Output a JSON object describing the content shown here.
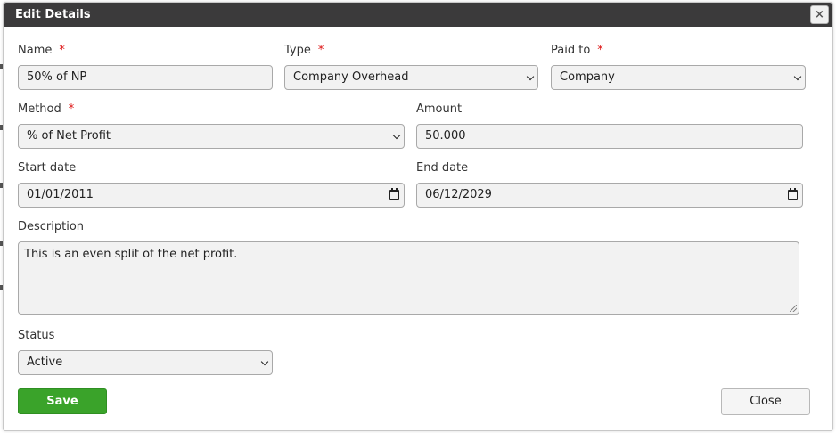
{
  "dialog": {
    "title": "Edit Details",
    "close_icon": "×"
  },
  "form": {
    "name": {
      "label": "Name",
      "required_mark": "*",
      "value": "50% of NP"
    },
    "type": {
      "label": "Type",
      "required_mark": "*",
      "value": "Company Overhead"
    },
    "paid_to": {
      "label": "Paid to",
      "required_mark": "*",
      "value": "Company"
    },
    "method": {
      "label": "Method",
      "required_mark": "*",
      "value": "% of Net Profit"
    },
    "amount": {
      "label": "Amount",
      "value": "50.000"
    },
    "start_date": {
      "label": "Start date",
      "value": "01/01/2011"
    },
    "end_date": {
      "label": "End date",
      "value": "06/12/2029"
    },
    "description": {
      "label": "Description",
      "value": "This is an even split of the net profit."
    },
    "status": {
      "label": "Status",
      "value": "Active"
    }
  },
  "buttons": {
    "save_label": "Save",
    "close_label": "Close"
  },
  "colors": {
    "titlebar": "#3b3a3b",
    "save_button": "#3aa32a",
    "required": "#dd1111"
  },
  "icons": {
    "dialog_close": "close-icon",
    "select": "chevron-down-icon",
    "date": "calendar-icon"
  }
}
